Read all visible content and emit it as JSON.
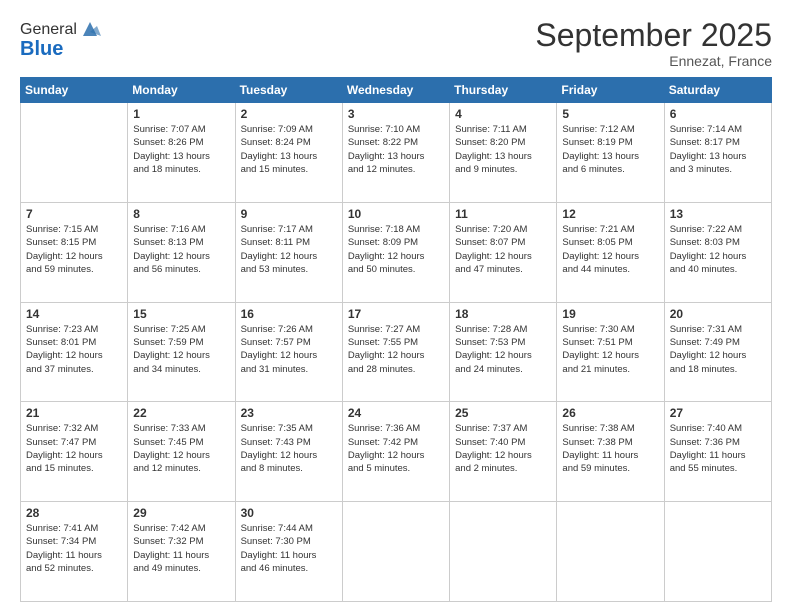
{
  "header": {
    "logo_general": "General",
    "logo_blue": "Blue",
    "title": "September 2025",
    "subtitle": "Ennezat, France"
  },
  "days_header": [
    "Sunday",
    "Monday",
    "Tuesday",
    "Wednesday",
    "Thursday",
    "Friday",
    "Saturday"
  ],
  "weeks": [
    [
      {
        "day": "",
        "info": ""
      },
      {
        "day": "1",
        "info": "Sunrise: 7:07 AM\nSunset: 8:26 PM\nDaylight: 13 hours\nand 18 minutes."
      },
      {
        "day": "2",
        "info": "Sunrise: 7:09 AM\nSunset: 8:24 PM\nDaylight: 13 hours\nand 15 minutes."
      },
      {
        "day": "3",
        "info": "Sunrise: 7:10 AM\nSunset: 8:22 PM\nDaylight: 13 hours\nand 12 minutes."
      },
      {
        "day": "4",
        "info": "Sunrise: 7:11 AM\nSunset: 8:20 PM\nDaylight: 13 hours\nand 9 minutes."
      },
      {
        "day": "5",
        "info": "Sunrise: 7:12 AM\nSunset: 8:19 PM\nDaylight: 13 hours\nand 6 minutes."
      },
      {
        "day": "6",
        "info": "Sunrise: 7:14 AM\nSunset: 8:17 PM\nDaylight: 13 hours\nand 3 minutes."
      }
    ],
    [
      {
        "day": "7",
        "info": "Sunrise: 7:15 AM\nSunset: 8:15 PM\nDaylight: 12 hours\nand 59 minutes."
      },
      {
        "day": "8",
        "info": "Sunrise: 7:16 AM\nSunset: 8:13 PM\nDaylight: 12 hours\nand 56 minutes."
      },
      {
        "day": "9",
        "info": "Sunrise: 7:17 AM\nSunset: 8:11 PM\nDaylight: 12 hours\nand 53 minutes."
      },
      {
        "day": "10",
        "info": "Sunrise: 7:18 AM\nSunset: 8:09 PM\nDaylight: 12 hours\nand 50 minutes."
      },
      {
        "day": "11",
        "info": "Sunrise: 7:20 AM\nSunset: 8:07 PM\nDaylight: 12 hours\nand 47 minutes."
      },
      {
        "day": "12",
        "info": "Sunrise: 7:21 AM\nSunset: 8:05 PM\nDaylight: 12 hours\nand 44 minutes."
      },
      {
        "day": "13",
        "info": "Sunrise: 7:22 AM\nSunset: 8:03 PM\nDaylight: 12 hours\nand 40 minutes."
      }
    ],
    [
      {
        "day": "14",
        "info": "Sunrise: 7:23 AM\nSunset: 8:01 PM\nDaylight: 12 hours\nand 37 minutes."
      },
      {
        "day": "15",
        "info": "Sunrise: 7:25 AM\nSunset: 7:59 PM\nDaylight: 12 hours\nand 34 minutes."
      },
      {
        "day": "16",
        "info": "Sunrise: 7:26 AM\nSunset: 7:57 PM\nDaylight: 12 hours\nand 31 minutes."
      },
      {
        "day": "17",
        "info": "Sunrise: 7:27 AM\nSunset: 7:55 PM\nDaylight: 12 hours\nand 28 minutes."
      },
      {
        "day": "18",
        "info": "Sunrise: 7:28 AM\nSunset: 7:53 PM\nDaylight: 12 hours\nand 24 minutes."
      },
      {
        "day": "19",
        "info": "Sunrise: 7:30 AM\nSunset: 7:51 PM\nDaylight: 12 hours\nand 21 minutes."
      },
      {
        "day": "20",
        "info": "Sunrise: 7:31 AM\nSunset: 7:49 PM\nDaylight: 12 hours\nand 18 minutes."
      }
    ],
    [
      {
        "day": "21",
        "info": "Sunrise: 7:32 AM\nSunset: 7:47 PM\nDaylight: 12 hours\nand 15 minutes."
      },
      {
        "day": "22",
        "info": "Sunrise: 7:33 AM\nSunset: 7:45 PM\nDaylight: 12 hours\nand 12 minutes."
      },
      {
        "day": "23",
        "info": "Sunrise: 7:35 AM\nSunset: 7:43 PM\nDaylight: 12 hours\nand 8 minutes."
      },
      {
        "day": "24",
        "info": "Sunrise: 7:36 AM\nSunset: 7:42 PM\nDaylight: 12 hours\nand 5 minutes."
      },
      {
        "day": "25",
        "info": "Sunrise: 7:37 AM\nSunset: 7:40 PM\nDaylight: 12 hours\nand 2 minutes."
      },
      {
        "day": "26",
        "info": "Sunrise: 7:38 AM\nSunset: 7:38 PM\nDaylight: 11 hours\nand 59 minutes."
      },
      {
        "day": "27",
        "info": "Sunrise: 7:40 AM\nSunset: 7:36 PM\nDaylight: 11 hours\nand 55 minutes."
      }
    ],
    [
      {
        "day": "28",
        "info": "Sunrise: 7:41 AM\nSunset: 7:34 PM\nDaylight: 11 hours\nand 52 minutes."
      },
      {
        "day": "29",
        "info": "Sunrise: 7:42 AM\nSunset: 7:32 PM\nDaylight: 11 hours\nand 49 minutes."
      },
      {
        "day": "30",
        "info": "Sunrise: 7:44 AM\nSunset: 7:30 PM\nDaylight: 11 hours\nand 46 minutes."
      },
      {
        "day": "",
        "info": ""
      },
      {
        "day": "",
        "info": ""
      },
      {
        "day": "",
        "info": ""
      },
      {
        "day": "",
        "info": ""
      }
    ]
  ]
}
